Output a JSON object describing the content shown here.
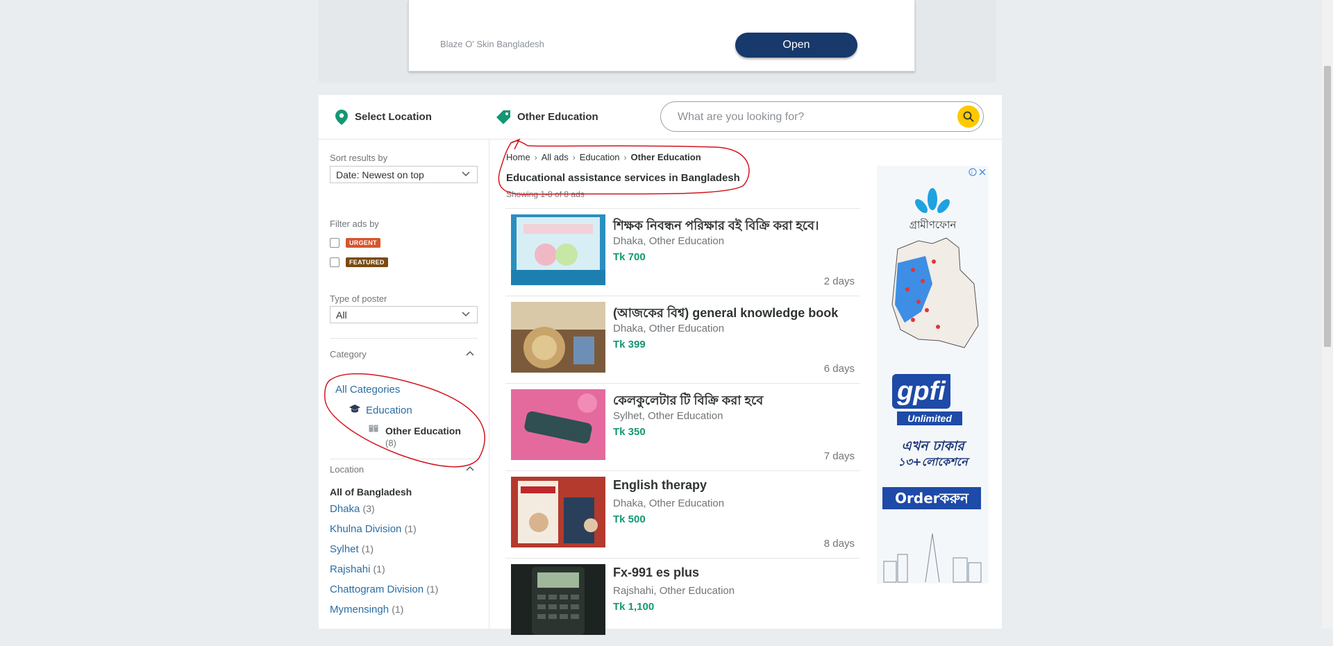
{
  "top_ad": {
    "advertiser": "Blaze O' Skin Bangladesh",
    "button": "Open"
  },
  "topbar": {
    "location": "Select Location",
    "category": "Other Education",
    "search_placeholder": "What are you looking for?"
  },
  "sidebar": {
    "sort_label": "Sort results by",
    "sort_value": "Date: Newest on top",
    "filter_label": "Filter ads by",
    "filters": [
      "URGENT",
      "FEATURED"
    ],
    "poster_label": "Type of poster",
    "poster_value": "All",
    "category_label": "Category",
    "all_categories": "All Categories",
    "education": "Education",
    "other_education": "Other Education",
    "other_education_count": "(8)",
    "location_label": "Location",
    "all_bangladesh": "All of Bangladesh",
    "locations": [
      {
        "name": "Dhaka",
        "count": "(3)"
      },
      {
        "name": "Khulna Division",
        "count": "(1)"
      },
      {
        "name": "Sylhet",
        "count": "(1)"
      },
      {
        "name": "Rajshahi",
        "count": "(1)"
      },
      {
        "name": "Chattogram Division",
        "count": "(1)"
      },
      {
        "name": "Mymensingh",
        "count": "(1)"
      }
    ]
  },
  "breadcrumb": [
    "Home",
    "All ads",
    "Education",
    "Other Education"
  ],
  "results_title": "Educational assistance services in Bangladesh",
  "showing": "Showing 1-8 of 8 ads",
  "listings": [
    {
      "title": "শিক্ষক নিবন্ধন পরিক্ষার বই বিক্রি করা হবে।",
      "meta": "Dhaka, Other Education",
      "price": "Tk 700",
      "age": "2 days"
    },
    {
      "title": "(আজকের বিশ্ব) general knowledge book",
      "meta": "Dhaka, Other Education",
      "price": "Tk 399",
      "age": "6 days"
    },
    {
      "title": "কেলকুলেটার টি বিক্রি করা হবে",
      "meta": "Sylhet, Other Education",
      "price": "Tk 350",
      "age": "7 days"
    },
    {
      "title": "English therapy",
      "meta": "Dhaka, Other Education",
      "price": "Tk 500",
      "age": "8 days"
    },
    {
      "title": "Fx-991 es plus",
      "meta": "Rajshahi, Other Education",
      "price": "Tk 1,100",
      "age": ""
    }
  ],
  "side_ad": {
    "brand": "গ্রামীণফোন",
    "logo": "gpfi",
    "tagline": "Unlimited",
    "line1": "এখন ঢাকার",
    "line2": "১৩+লোকেশনে",
    "cta": "Orderকরুন"
  },
  "icons": {
    "location": "map-pin-icon",
    "category": "tag-icon",
    "search": "search-icon",
    "education": "graduation-cap-icon",
    "other_education": "book-icon"
  },
  "colors": {
    "brand_green": "#149773",
    "search_yellow": "#ffc800",
    "link_blue": "#2b6ea4",
    "open_button": "#17396b",
    "annotation_red": "#d2141c"
  }
}
